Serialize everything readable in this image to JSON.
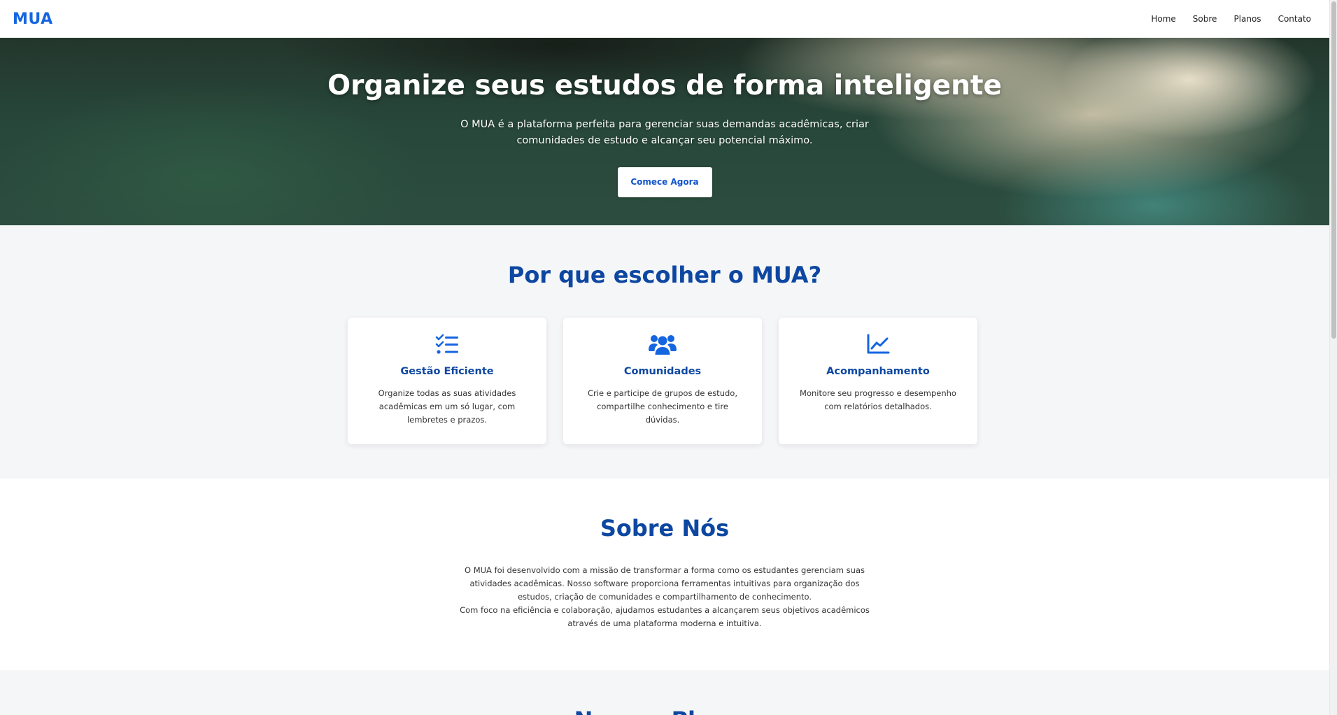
{
  "header": {
    "logo": "MUA",
    "nav": [
      "Home",
      "Sobre",
      "Planos",
      "Contato"
    ]
  },
  "hero": {
    "title": "Organize seus estudos de forma inteligente",
    "subtitle": "O MUA é a plataforma perfeita para gerenciar suas demandas acadêmicas, criar comunidades de estudo e alcançar seu potencial máximo.",
    "cta": "Comece Agora"
  },
  "features": {
    "title": "Por que escolher o MUA?",
    "cards": [
      {
        "icon": "task-list-icon",
        "title": "Gestão Eficiente",
        "text": "Organize todas as suas atividades acadêmicas em um só lugar, com lembretes e prazos."
      },
      {
        "icon": "users-group-icon",
        "title": "Comunidades",
        "text": "Crie e participe de grupos de estudo, compartilhe conhecimento e tire dúvidas."
      },
      {
        "icon": "line-chart-icon",
        "title": "Acompanhamento",
        "text": "Monitore seu progresso e desempenho com relatórios detalhados."
      }
    ]
  },
  "about": {
    "title": "Sobre Nós",
    "paragraph1": "O MUA foi desenvolvido com a missão de transformar a forma como os estudantes gerenciam suas atividades acadêmicas. Nosso software proporciona ferramentas intuitivas para organização dos estudos, criação de comunidades e compartilhamento de conhecimento.",
    "paragraph2": "Com foco na eficiência e colaboração, ajudamos estudantes a alcançarem seus objetivos acadêmicos através de uma plataforma moderna e intuitiva."
  },
  "plans": {
    "title": "Nossos Planos"
  },
  "colors": {
    "brand": "#1565e0",
    "heading": "#0d47a1",
    "background": "#f5f6f8"
  }
}
